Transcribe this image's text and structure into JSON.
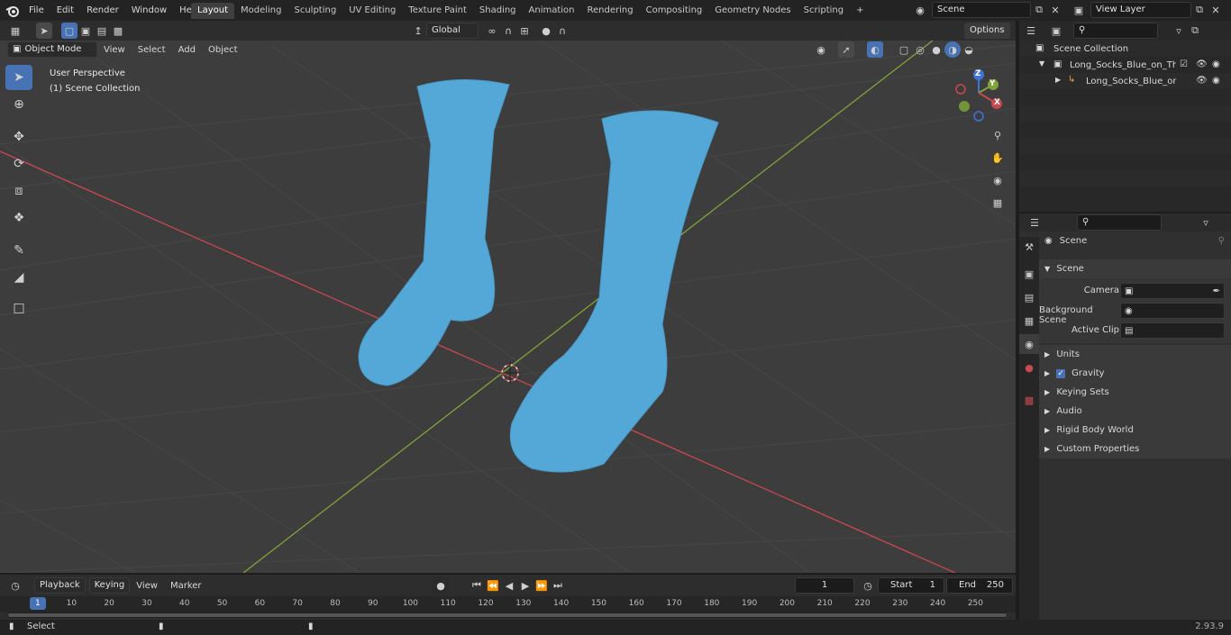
{
  "topbar": {
    "menus": [
      "File",
      "Edit",
      "Render",
      "Window",
      "Help"
    ],
    "workspaces": [
      "Layout",
      "Modeling",
      "Sculpting",
      "UV Editing",
      "Texture Paint",
      "Shading",
      "Animation",
      "Rendering",
      "Compositing",
      "Geometry Nodes",
      "Scripting"
    ],
    "add_tab": "+",
    "scene_name": "Scene",
    "view_layer": "View Layer"
  },
  "viewport_header": {
    "mode": "Object Mode",
    "menus": [
      "View",
      "Select",
      "Add",
      "Object"
    ],
    "orientation": "Global",
    "options": "Options"
  },
  "viewport": {
    "perspective": "User Perspective",
    "collection": "(1) Scene Collection",
    "gizmo_axes": [
      "Z",
      "Y",
      "X"
    ]
  },
  "outliner": {
    "root": "Scene Collection",
    "items": [
      {
        "label": "Long_Socks_Blue_on_The_Fo"
      },
      {
        "label": "Long_Socks_Blue_on_The"
      }
    ]
  },
  "properties": {
    "header": "Scene",
    "panel": "Scene",
    "fields": [
      {
        "label": "Camera"
      },
      {
        "label": "Background Scene"
      },
      {
        "label": "Active Clip"
      }
    ],
    "subpanels": [
      "Units",
      "Gravity",
      "Keying Sets",
      "Audio",
      "Rigid Body World",
      "Custom Properties"
    ]
  },
  "timeline": {
    "menus": [
      "Playback",
      "Keying",
      "View",
      "Marker"
    ],
    "current_frame": "1",
    "start_label": "Start",
    "start": "1",
    "end_label": "End",
    "end": "250",
    "ruler": [
      "1",
      "10",
      "20",
      "30",
      "40",
      "50",
      "60",
      "70",
      "80",
      "90",
      "100",
      "110",
      "120",
      "130",
      "140",
      "150",
      "160",
      "170",
      "180",
      "190",
      "200",
      "210",
      "220",
      "230",
      "240",
      "250"
    ]
  },
  "status": {
    "left": "Select",
    "version": "2.93.9"
  },
  "colors": {
    "accent": "#4772b3",
    "sock": "#54a8d8",
    "x_axis": "#c8484f",
    "y_axis": "#7ea33a",
    "viewport_bg": "#3d3d3d"
  }
}
